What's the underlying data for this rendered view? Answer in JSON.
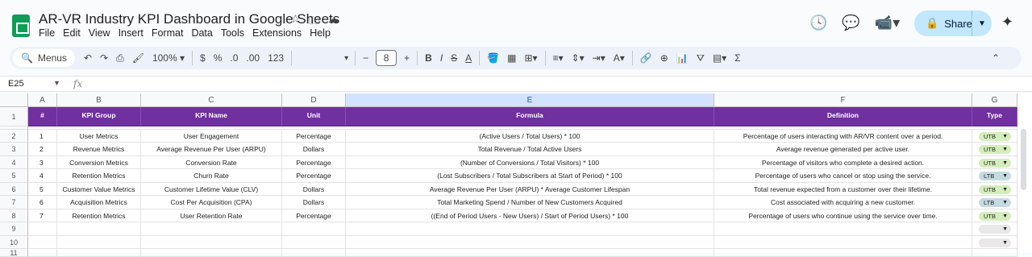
{
  "app": {
    "title": "AR-VR Industry KPI Dashboard in Google Sheets",
    "menu": [
      "File",
      "Edit",
      "View",
      "Insert",
      "Format",
      "Data",
      "Tools",
      "Extensions",
      "Help"
    ],
    "share_label": "Share"
  },
  "toolbar": {
    "menus_label": "Menus",
    "zoom": "100%",
    "currency": "$",
    "percent": "%",
    "decrease_decimal": ".0",
    "increase_decimal": ".00",
    "number_format": "123",
    "font_size": "8"
  },
  "formula_bar": {
    "cell_ref": "E25",
    "fx_label": "fx"
  },
  "columns": [
    "A",
    "B",
    "C",
    "D",
    "E",
    "F",
    "G"
  ],
  "selected_column": "E",
  "row_numbers": [
    "1",
    "2",
    "3",
    "4",
    "5",
    "6",
    "7",
    "8",
    "9",
    "10",
    "11"
  ],
  "table": {
    "headers": [
      "#",
      "KPI Group",
      "KPI Name",
      "Unit",
      "Formula",
      "Definition",
      "Type"
    ],
    "rows": [
      {
        "num": "1",
        "group": "User Metrics",
        "name": "User Engagement",
        "unit": "Percentage",
        "formula": "(Active Users / Total Users) * 100",
        "definition": "Percentage of users interacting with AR/VR content over a period.",
        "type": "UTB"
      },
      {
        "num": "2",
        "group": "Revenue Metrics",
        "name": "Average Revenue Per User (ARPU)",
        "unit": "Dollars",
        "formula": "Total Revenue / Total Active Users",
        "definition": "Average revenue generated per active user.",
        "type": "UTB"
      },
      {
        "num": "3",
        "group": "Conversion Metrics",
        "name": "Conversion Rate",
        "unit": "Percentage",
        "formula": "(Number of Conversions / Total Visitors) * 100",
        "definition": "Percentage of visitors who complete a desired action.",
        "type": "UTB"
      },
      {
        "num": "4",
        "group": "Retention Metrics",
        "name": "Churn Rate",
        "unit": "Percentage",
        "formula": "(Lost Subscribers / Total Subscribers at Start of Period) * 100",
        "definition": "Percentage of users who cancel or stop using the service.",
        "type": "LTB"
      },
      {
        "num": "5",
        "group": "Customer Value Metrics",
        "name": "Customer Lifetime Value (CLV)",
        "unit": "Dollars",
        "formula": "Average Revenue Per User (ARPU) * Average Customer Lifespan",
        "definition": "Total revenue expected from a customer over their lifetime.",
        "type": "UTB"
      },
      {
        "num": "6",
        "group": "Acquisition Metrics",
        "name": "Cost Per Acquisition (CPA)",
        "unit": "Dollars",
        "formula": "Total Marketing Spend / Number of New Customers Acquired",
        "definition": "Cost associated with acquiring a new customer.",
        "type": "LTB"
      },
      {
        "num": "7",
        "group": "Retention Metrics",
        "name": "User Retention Rate",
        "unit": "Percentage",
        "formula": "((End of Period Users - New Users) / Start of Period Users) * 100",
        "definition": "Percentage of users who continue using the service over time.",
        "type": "UTB"
      }
    ]
  },
  "colors": {
    "header_purple": "#7030a0",
    "utb_chip": "#d4edbc",
    "ltb_chip": "#c6dbe1",
    "share_button": "#c2e7ff"
  }
}
